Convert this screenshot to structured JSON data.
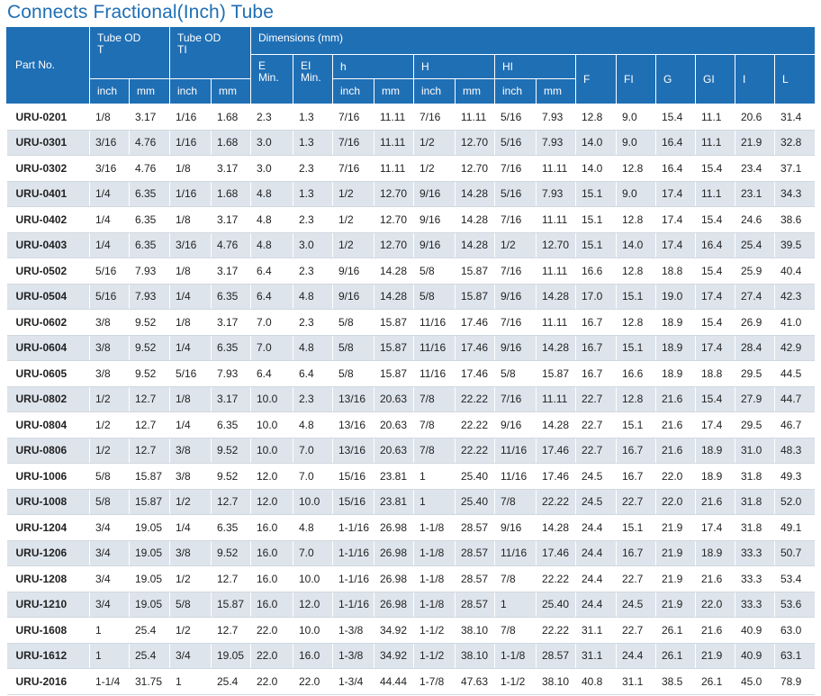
{
  "title": "Connects Fractional(Inch) Tube",
  "header": {
    "part_no": "Part No.",
    "tube_od_t": "Tube OD",
    "tube_od_t_sub": "T",
    "tube_od_ti": "Tube OD",
    "tube_od_ti_sub": "TI",
    "dimensions": "Dimensions (mm)",
    "e_min": "E",
    "e_min_sub": "Min.",
    "ei_min": "EI",
    "ei_min_sub": "Min.",
    "h": "h",
    "H": "H",
    "HI": "HI",
    "F": "F",
    "FI": "FI",
    "G": "G",
    "GI": "GI",
    "I": "I",
    "L": "L",
    "inch": "inch",
    "mm": "mm"
  },
  "rows": [
    [
      "URU-0201",
      "1/8",
      "3.17",
      "1/16",
      "1.68",
      "2.3",
      "1.3",
      "7/16",
      "11.11",
      "7/16",
      "11.11",
      "5/16",
      "7.93",
      "12.8",
      "9.0",
      "15.4",
      "11.1",
      "20.6",
      "31.4"
    ],
    [
      "URU-0301",
      "3/16",
      "4.76",
      "1/16",
      "1.68",
      "3.0",
      "1.3",
      "7/16",
      "11.11",
      "1/2",
      "12.70",
      "5/16",
      "7.93",
      "14.0",
      "9.0",
      "16.4",
      "11.1",
      "21.9",
      "32.8"
    ],
    [
      "URU-0302",
      "3/16",
      "4.76",
      "1/8",
      "3.17",
      "3.0",
      "2.3",
      "7/16",
      "11.11",
      "1/2",
      "12.70",
      "7/16",
      "11.11",
      "14.0",
      "12.8",
      "16.4",
      "15.4",
      "23.4",
      "37.1"
    ],
    [
      "URU-0401",
      "1/4",
      "6.35",
      "1/16",
      "1.68",
      "4.8",
      "1.3",
      "1/2",
      "12.70",
      "9/16",
      "14.28",
      "5/16",
      "7.93",
      "15.1",
      "9.0",
      "17.4",
      "11.1",
      "23.1",
      "34.3"
    ],
    [
      "URU-0402",
      "1/4",
      "6.35",
      "1/8",
      "3.17",
      "4.8",
      "2.3",
      "1/2",
      "12.70",
      "9/16",
      "14.28",
      "7/16",
      "11.11",
      "15.1",
      "12.8",
      "17.4",
      "15.4",
      "24.6",
      "38.6"
    ],
    [
      "URU-0403",
      "1/4",
      "6.35",
      "3/16",
      "4.76",
      "4.8",
      "3.0",
      "1/2",
      "12.70",
      "9/16",
      "14.28",
      "1/2",
      "12.70",
      "15.1",
      "14.0",
      "17.4",
      "16.4",
      "25.4",
      "39.5"
    ],
    [
      "URU-0502",
      "5/16",
      "7.93",
      "1/8",
      "3.17",
      "6.4",
      "2.3",
      "9/16",
      "14.28",
      "5/8",
      "15.87",
      "7/16",
      "11.11",
      "16.6",
      "12.8",
      "18.8",
      "15.4",
      "25.9",
      "40.4"
    ],
    [
      "URU-0504",
      "5/16",
      "7.93",
      "1/4",
      "6.35",
      "6.4",
      "4.8",
      "9/16",
      "14.28",
      "5/8",
      "15.87",
      "9/16",
      "14.28",
      "17.0",
      "15.1",
      "19.0",
      "17.4",
      "27.4",
      "42.3"
    ],
    [
      "URU-0602",
      "3/8",
      "9.52",
      "1/8",
      "3.17",
      "7.0",
      "2.3",
      "5/8",
      "15.87",
      "11/16",
      "17.46",
      "7/16",
      "11.11",
      "16.7",
      "12.8",
      "18.9",
      "15.4",
      "26.9",
      "41.0"
    ],
    [
      "URU-0604",
      "3/8",
      "9.52",
      "1/4",
      "6.35",
      "7.0",
      "4.8",
      "5/8",
      "15.87",
      "11/16",
      "17.46",
      "9/16",
      "14.28",
      "16.7",
      "15.1",
      "18.9",
      "17.4",
      "28.4",
      "42.9"
    ],
    [
      "URU-0605",
      "3/8",
      "9.52",
      "5/16",
      "7.93",
      "6.4",
      "6.4",
      "5/8",
      "15.87",
      "11/16",
      "17.46",
      "5/8",
      "15.87",
      "16.7",
      "16.6",
      "18.9",
      "18.8",
      "29.5",
      "44.5"
    ],
    [
      "URU-0802",
      "1/2",
      "12.7",
      "1/8",
      "3.17",
      "10.0",
      "2.3",
      "13/16",
      "20.63",
      "7/8",
      "22.22",
      "7/16",
      "11.11",
      "22.7",
      "12.8",
      "21.6",
      "15.4",
      "27.9",
      "44.7"
    ],
    [
      "URU-0804",
      "1/2",
      "12.7",
      "1/4",
      "6.35",
      "10.0",
      "4.8",
      "13/16",
      "20.63",
      "7/8",
      "22.22",
      "9/16",
      "14.28",
      "22.7",
      "15.1",
      "21.6",
      "17.4",
      "29.5",
      "46.7"
    ],
    [
      "URU-0806",
      "1/2",
      "12.7",
      "3/8",
      "9.52",
      "10.0",
      "7.0",
      "13/16",
      "20.63",
      "7/8",
      "22.22",
      "11/16",
      "17.46",
      "22.7",
      "16.7",
      "21.6",
      "18.9",
      "31.0",
      "48.3"
    ],
    [
      "URU-1006",
      "5/8",
      "15.87",
      "3/8",
      "9.52",
      "12.0",
      "7.0",
      "15/16",
      "23.81",
      "1",
      "25.40",
      "11/16",
      "17.46",
      "24.5",
      "16.7",
      "22.0",
      "18.9",
      "31.8",
      "49.3"
    ],
    [
      "URU-1008",
      "5/8",
      "15.87",
      "1/2",
      "12.7",
      "12.0",
      "10.0",
      "15/16",
      "23.81",
      "1",
      "25.40",
      "7/8",
      "22.22",
      "24.5",
      "22.7",
      "22.0",
      "21.6",
      "31.8",
      "52.0"
    ],
    [
      "URU-1204",
      "3/4",
      "19.05",
      "1/4",
      "6.35",
      "16.0",
      "4.8",
      "1-1/16",
      "26.98",
      "1-1/8",
      "28.57",
      "9/16",
      "14.28",
      "24.4",
      "15.1",
      "21.9",
      "17.4",
      "31.8",
      "49.1"
    ],
    [
      "URU-1206",
      "3/4",
      "19.05",
      "3/8",
      "9.52",
      "16.0",
      "7.0",
      "1-1/16",
      "26.98",
      "1-1/8",
      "28.57",
      "11/16",
      "17.46",
      "24.4",
      "16.7",
      "21.9",
      "18.9",
      "33.3",
      "50.7"
    ],
    [
      "URU-1208",
      "3/4",
      "19.05",
      "1/2",
      "12.7",
      "16.0",
      "10.0",
      "1-1/16",
      "26.98",
      "1-1/8",
      "28.57",
      "7/8",
      "22.22",
      "24.4",
      "22.7",
      "21.9",
      "21.6",
      "33.3",
      "53.4"
    ],
    [
      "URU-1210",
      "3/4",
      "19.05",
      "5/8",
      "15.87",
      "16.0",
      "12.0",
      "1-1/16",
      "26.98",
      "1-1/8",
      "28.57",
      "1",
      "25.40",
      "24.4",
      "24.5",
      "21.9",
      "22.0",
      "33.3",
      "53.6"
    ],
    [
      "URU-1608",
      "1",
      "25.4",
      "1/2",
      "12.7",
      "22.0",
      "10.0",
      "1-3/8",
      "34.92",
      "1-1/2",
      "38.10",
      "7/8",
      "22.22",
      "31.1",
      "22.7",
      "26.1",
      "21.6",
      "40.9",
      "63.0"
    ],
    [
      "URU-1612",
      "1",
      "25.4",
      "3/4",
      "19.05",
      "22.0",
      "16.0",
      "1-3/8",
      "34.92",
      "1-1/2",
      "38.10",
      "1-1/8",
      "28.57",
      "31.1",
      "24.4",
      "26.1",
      "21.9",
      "40.9",
      "63.1"
    ],
    [
      "URU-2016",
      "1-1/4",
      "31.75",
      "1",
      "25.4",
      "22.0",
      "22.0",
      "1-3/4",
      "44.44",
      "1-7/8",
      "47.63",
      "1-1/2",
      "38.10",
      "40.8",
      "31.1",
      "38.5",
      "26.1",
      "45.0",
      "78.9"
    ]
  ]
}
